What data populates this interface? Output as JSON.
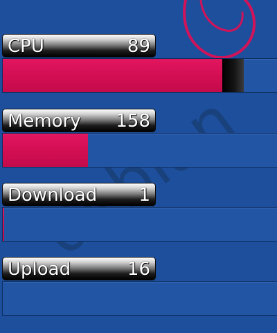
{
  "background": {
    "color": "#1d4f9c",
    "swirl_color": "#d1135a",
    "watermark_text": "debian",
    "watermark_color": "#1a3f79"
  },
  "monitors": [
    {
      "label": "CPU",
      "value": "89",
      "fill_fraction": 0.8,
      "peak_fraction": 0.88
    },
    {
      "label": "Memory",
      "value": "158",
      "fill_fraction": 0.31,
      "peak_fraction": 0.31
    },
    {
      "label": "Download",
      "value": "1",
      "fill_fraction": 0.005,
      "peak_fraction": 0.005
    },
    {
      "label": "Upload",
      "value": "16",
      "fill_fraction": 0.0,
      "peak_fraction": 0.0
    }
  ],
  "colors": {
    "bar_fill": "#d20e52",
    "bar_track": "#2255a3",
    "peak": "#111111"
  }
}
